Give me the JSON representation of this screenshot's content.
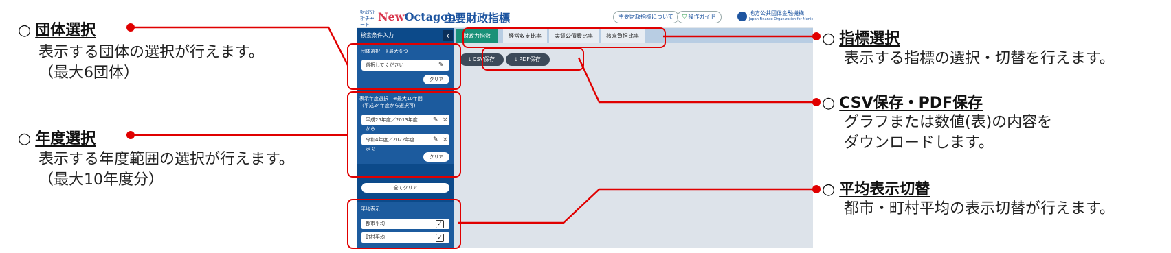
{
  "annotations": {
    "circle": "○",
    "org_select": {
      "title": "団体選択",
      "desc1": "表示する団体の選択が行えます。",
      "desc2": "（最大6団体）"
    },
    "year_select": {
      "title": "年度選択",
      "desc1": "表示する年度範囲の選択が行えます。",
      "desc2": "（最大10年度分）"
    },
    "indicator_select": {
      "title": "指標選択",
      "desc1": "表示する指標の選択・切替を行えます。"
    },
    "save": {
      "title": "CSV保存・PDF保存",
      "desc1": "グラフまたは数値(表)の内容を",
      "desc2": "ダウンロードします。"
    },
    "average": {
      "title": "平均表示切替",
      "desc1": "都市・町村平均の表示切替が行えます。"
    }
  },
  "app": {
    "brand_small": "財政分析チャート",
    "brand_new": "New",
    "brand_octagon": "Octagon",
    "title": "主要財政指標",
    "about_button": "主要財政指標について",
    "guide_button": "操作ガイド",
    "org_name_jp": "地方公共団体金融機構",
    "org_name_en": "Japan Finance Organization for Municipalities",
    "sidebar": {
      "heading": "検索条件入力",
      "collapse_icon": "‹",
      "org_label": "団体選択　※最大６つ",
      "org_placeholder": "選択してください",
      "clear": "クリア",
      "year_label1": "表示年度選択　※最大10年間",
      "year_label2": "（平成24年度から選択可)",
      "year_from": "平成25年度／2013年度",
      "from": "から",
      "year_to": "令和4年度／2022年度",
      "to": "まで",
      "clear_all": "全てクリア",
      "avg_label": "平均表示",
      "city_avg": "都市平均",
      "town_avg": "町村平均"
    },
    "tabs": [
      "財政力指数",
      "経常収支比率",
      "実質公債費比率",
      "将来負担比率"
    ],
    "csv_button": "CSV保存",
    "pdf_button": "PDF保存"
  },
  "colors": {
    "annotation_red": "#e00000",
    "sidebar_blue": "#0c4a8a",
    "active_tab": "#1a9178"
  }
}
